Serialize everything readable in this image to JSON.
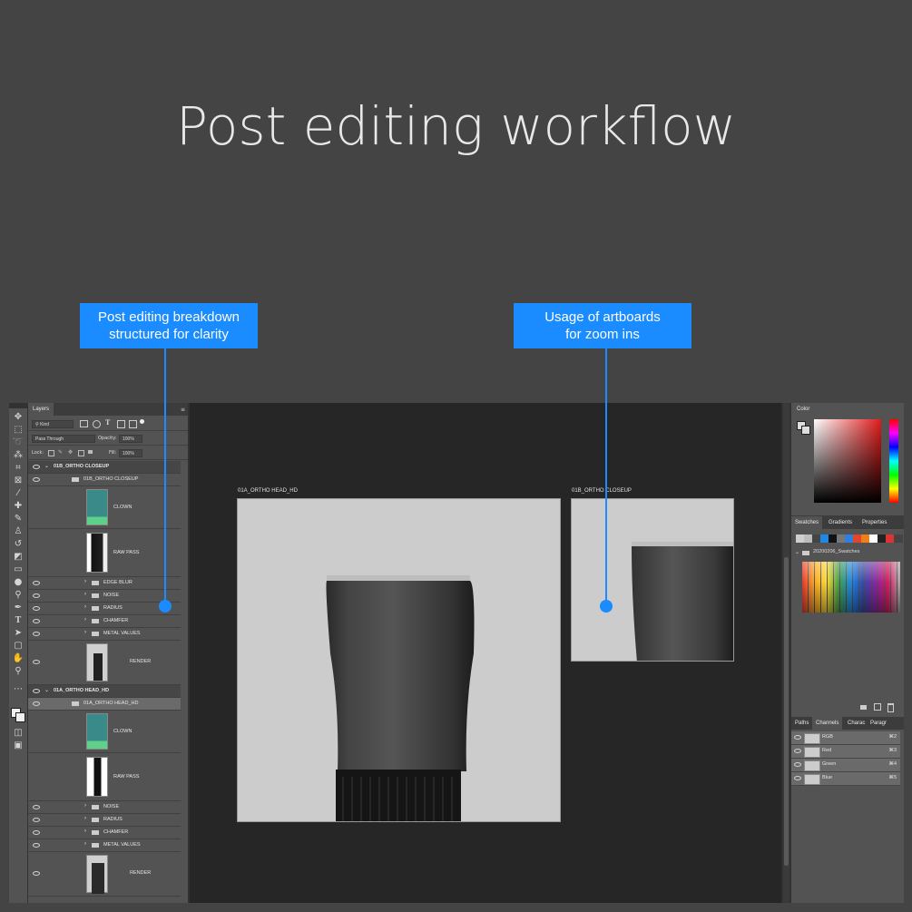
{
  "headline": "Post editing workflow",
  "callouts": {
    "left": {
      "line1": "Post editing breakdown",
      "line2": "structured for clarity"
    },
    "right": {
      "line1": "Usage of artboards",
      "line2": "for zoom ins"
    }
  },
  "layers_panel": {
    "tab": "Layers",
    "filter_kind": "Kind",
    "blend_mode": "Pass Through",
    "opacity_label": "Opacity:",
    "opacity_value": "100%",
    "lock_label": "Lock:",
    "fill_label": "Fill:",
    "fill_value": "100%",
    "groups": [
      {
        "name": "01B_ORTHO CLOSEUP",
        "subgroup": "01B_ORTHO CLOSEUP",
        "layers": [
          {
            "name": "CLOWN",
            "kind": "thumb"
          },
          {
            "name": "RAW PASS",
            "kind": "thumb"
          },
          {
            "name": "EDGE BLUR",
            "kind": "folder"
          },
          {
            "name": "NOISE",
            "kind": "folder"
          },
          {
            "name": "RADIUS",
            "kind": "folder"
          },
          {
            "name": "CHAMFER",
            "kind": "folder"
          },
          {
            "name": "METAL VALUES",
            "kind": "folder"
          },
          {
            "name": "RENDER",
            "kind": "thumb"
          }
        ]
      },
      {
        "name": "01A_ORTHO HEAD_HD",
        "subgroup": "01A_ORTHO HEAD_HD",
        "layers": [
          {
            "name": "CLOWN",
            "kind": "thumb"
          },
          {
            "name": "RAW PASS",
            "kind": "thumb"
          },
          {
            "name": "NOISE",
            "kind": "folder"
          },
          {
            "name": "RADIUS",
            "kind": "folder"
          },
          {
            "name": "CHAMFER",
            "kind": "folder"
          },
          {
            "name": "METAL VALUES",
            "kind": "folder"
          },
          {
            "name": "RENDER",
            "kind": "thumb"
          }
        ]
      }
    ]
  },
  "artboards": {
    "main_label": "01A_ORTHO HEAD_HD",
    "secondary_label": "01B_ORTHO CLOSEUP"
  },
  "right_panels": {
    "color_tab": "Color",
    "swatch_tabs": [
      "Swatches",
      "Gradients",
      "Properties"
    ],
    "swatch_folder": "20200206_Swatches",
    "channel_tabs": [
      "Paths",
      "Channels",
      "Charac",
      "Paragr"
    ],
    "channels": [
      {
        "name": "RGB",
        "shortcut": "⌘2"
      },
      {
        "name": "Red",
        "shortcut": "⌘3"
      },
      {
        "name": "Green",
        "shortcut": "⌘4"
      },
      {
        "name": "Blue",
        "shortcut": "⌘5"
      }
    ]
  },
  "colors": {
    "accent": "#1a8cff",
    "background": "#444444",
    "panel": "#535353",
    "canvas": "#262626",
    "artboard": "#cccccc"
  }
}
